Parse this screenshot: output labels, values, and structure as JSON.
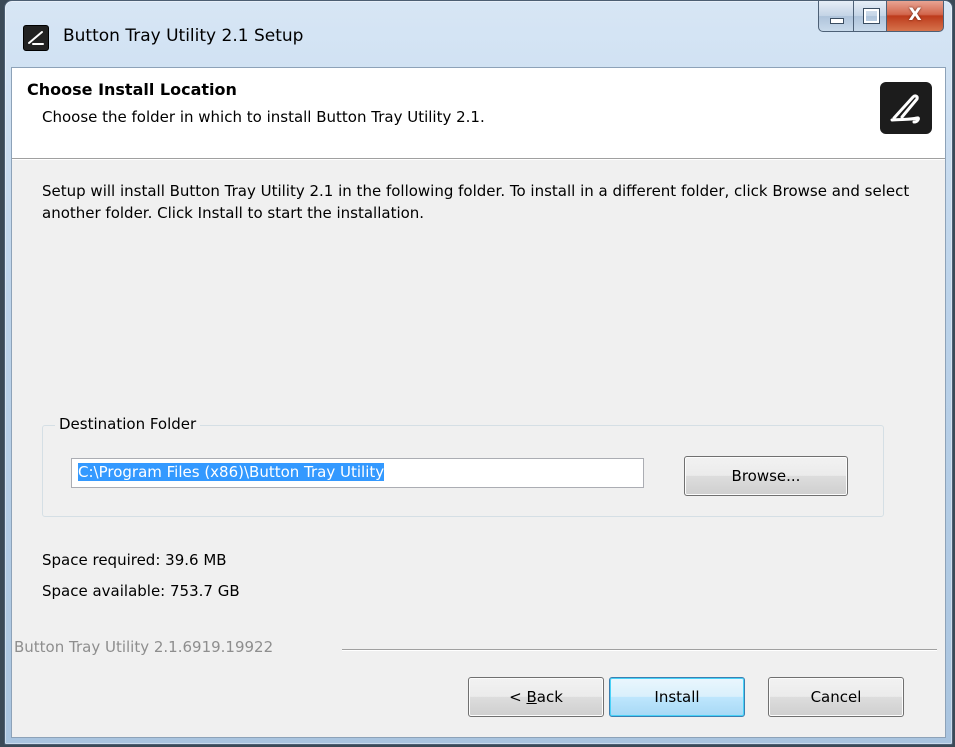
{
  "window": {
    "title": "Button Tray Utility 2.1 Setup",
    "controls": {
      "minimize_icon": "minimize-icon",
      "maximize_icon": "maximize-icon",
      "close_label": "X"
    }
  },
  "header": {
    "title": "Choose Install Location",
    "subtitle": "Choose the folder in which to install Button Tray Utility 2.1.",
    "icon": "pen-icon"
  },
  "description": "Setup will install Button Tray Utility 2.1 in the following folder. To install in a different folder, click Browse and select another folder. Click Install to start the installation.",
  "destination": {
    "legend": "Destination Folder",
    "path_value": "C:\\Program Files (x86)\\Button Tray Utility",
    "browse_label": "Browse..."
  },
  "space": {
    "required": "Space required: 39.6 MB",
    "available": "Space available: 753.7 GB"
  },
  "branding": "Button Tray Utility 2.1.6919.19922",
  "buttons": {
    "back_prefix": "< ",
    "back_accel": "B",
    "back_rest": "ack",
    "install": "Install",
    "cancel": "Cancel"
  },
  "colors": {
    "selection": "#3399ff",
    "titlebar": "#bcd3ea",
    "close": "#c84a2c"
  }
}
